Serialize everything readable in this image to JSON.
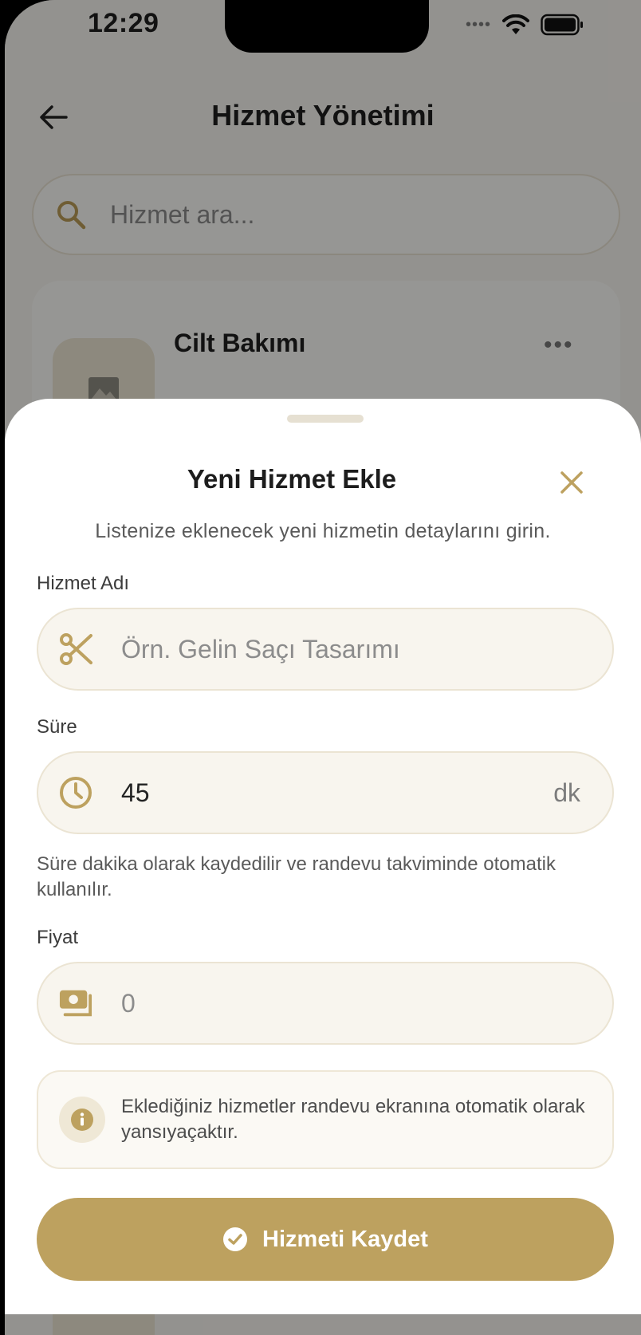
{
  "status_bar": {
    "time": "12:29",
    "signal": "••••"
  },
  "header": {
    "title": "Hizmet Yönetimi"
  },
  "search": {
    "placeholder": "Hizmet ara..."
  },
  "list": {
    "items": [
      {
        "title": "Cilt Bakımı"
      }
    ]
  },
  "sheet": {
    "title": "Yeni Hizmet Ekle",
    "subtitle": "Listenize eklenecek yeni hizmetin detaylarını girin.",
    "fields": {
      "name": {
        "label": "Hizmet Adı",
        "placeholder": "Örn. Gelin Saçı Tasarımı",
        "icon": "scissors-icon"
      },
      "duration": {
        "label": "Süre",
        "value": "45",
        "unit": "dk",
        "icon": "clock-icon"
      },
      "price": {
        "label": "Fiyat",
        "placeholder": "0",
        "icon": "cash-icon"
      }
    },
    "duration_hint": "Süre dakika olarak kaydedilir ve randevu takviminde otomatik kullanılır.",
    "info": "Eklediğiniz hizmetler randevu ekranına otomatik olarak yansıyaçaktır.",
    "save_label": "Hizmeti Kaydet"
  },
  "colors": {
    "accent": "#BDA15F",
    "field_bg": "#F8F5EE",
    "background": "#F6F4EF"
  }
}
